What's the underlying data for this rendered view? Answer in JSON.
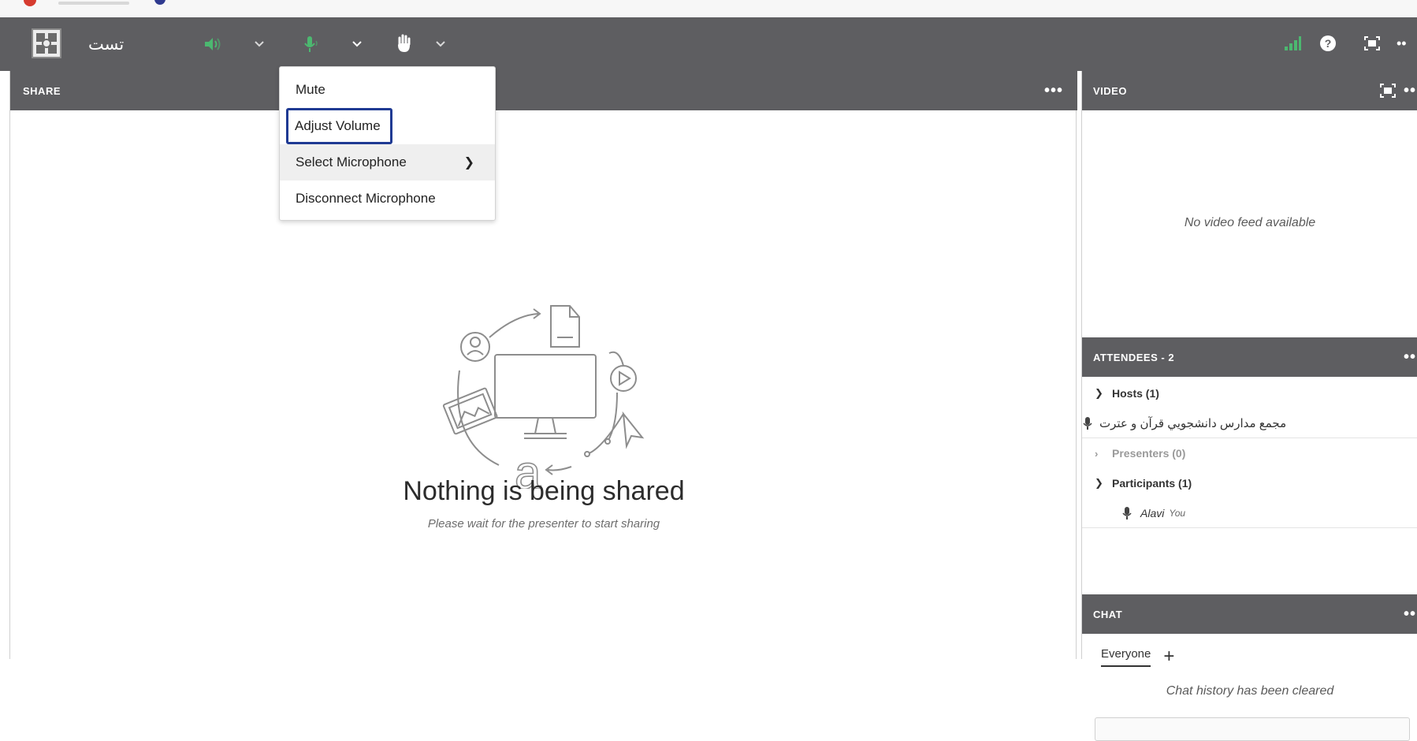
{
  "room": {
    "title": "تست"
  },
  "toolbar": {
    "speaker_icon": "speaker-icon",
    "mic_icon": "microphone-icon",
    "hand_icon": "raise-hand-icon",
    "right_icons": [
      "signal-bars-icon",
      "help-icon",
      "fullscreen-icon",
      "more-icon"
    ]
  },
  "share": {
    "header": "SHARE",
    "empty_title": "Nothing is being shared",
    "empty_subtitle": "Please wait for the presenter to start sharing"
  },
  "mic_menu": {
    "items": [
      {
        "label": "Mute"
      },
      {
        "label": "Adjust Volume"
      },
      {
        "label": "Select Microphone"
      },
      {
        "label": "Disconnect Microphone"
      }
    ]
  },
  "video": {
    "header": "VIDEO",
    "empty": "No video feed available"
  },
  "attendees": {
    "header": "ATTENDEES - 2",
    "hosts_label": "Hosts (1)",
    "host_name": "مجمع مدارس دانشجويي قرآن و عترت",
    "presenters_label": "Presenters (0)",
    "participants_label": "Participants (1)",
    "participant_name": "Alavi",
    "participant_you": "You"
  },
  "chat": {
    "header": "CHAT",
    "tab_everyone": "Everyone",
    "cleared": "Chat history has been cleared"
  },
  "colors": {
    "toolbar_bg": "#5e5e61",
    "accent_green": "#4cb870",
    "highlight_border": "#1f3a93"
  }
}
